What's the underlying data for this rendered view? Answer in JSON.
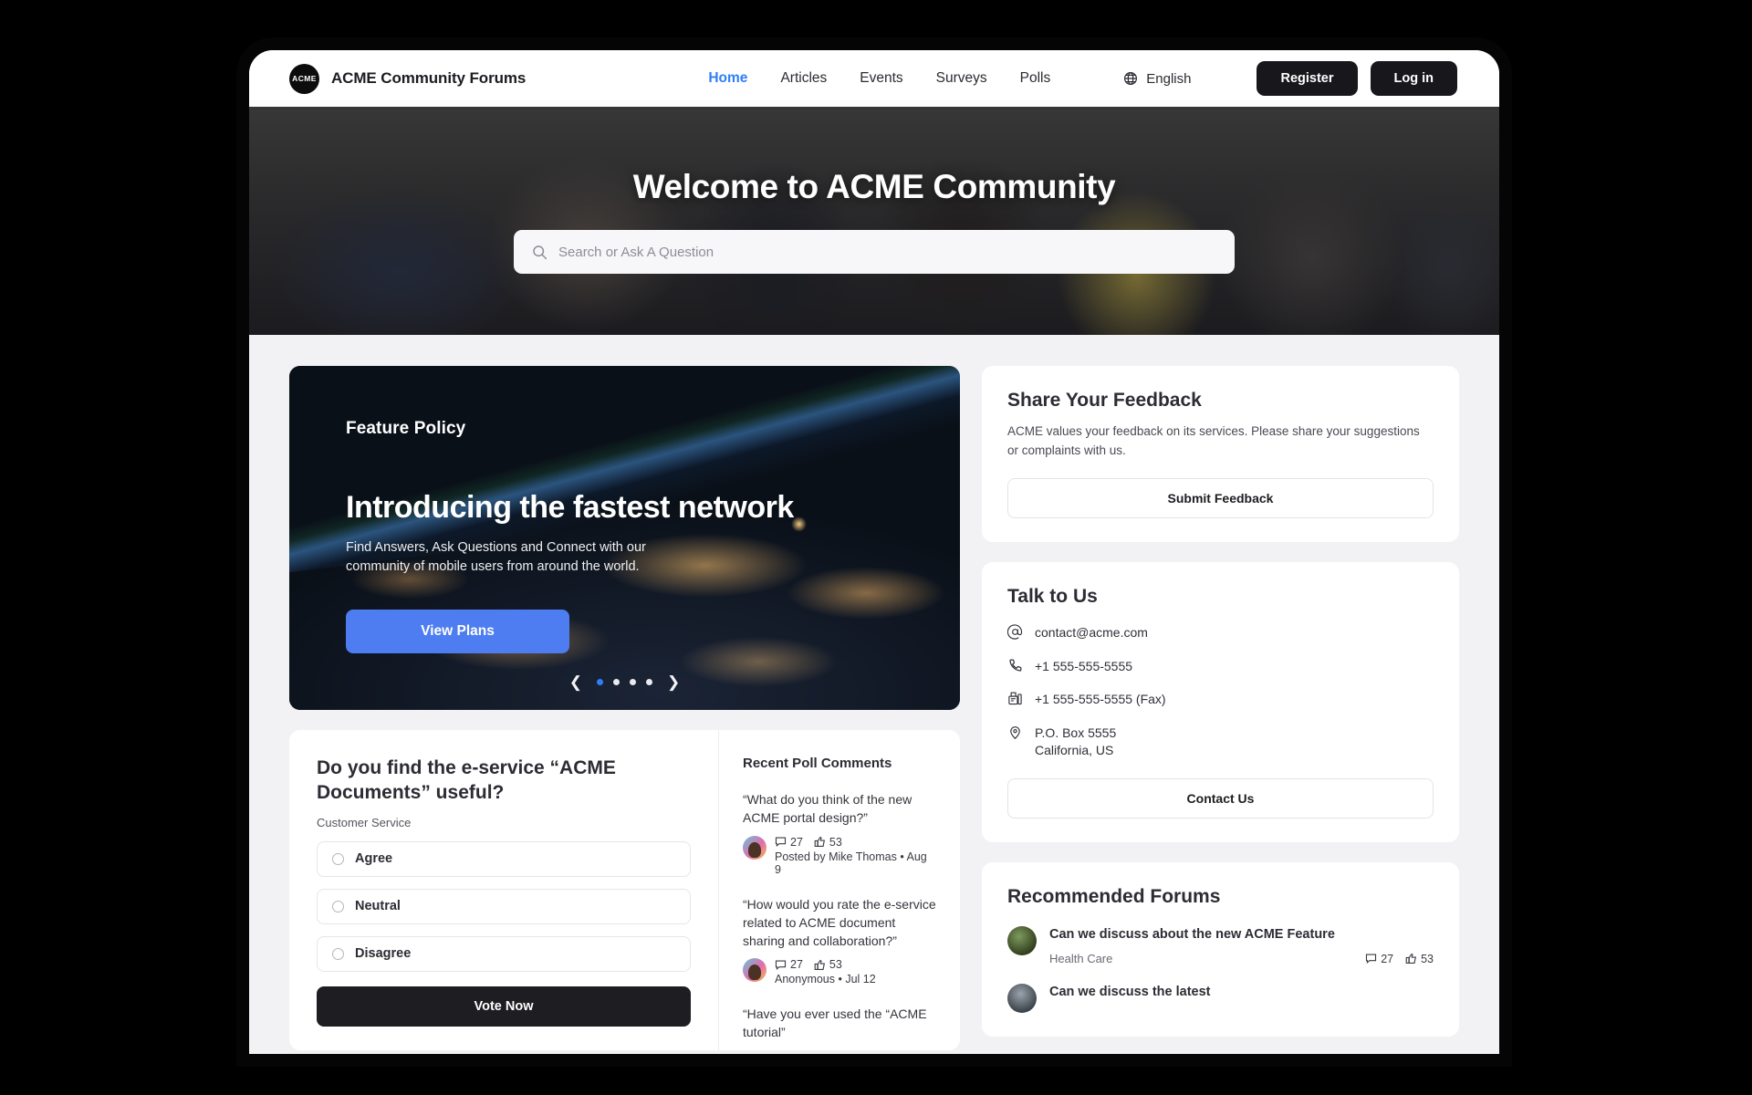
{
  "header": {
    "logo_text": "ACME",
    "brand": "ACME Community Forums",
    "nav": [
      {
        "label": "Home",
        "active": true
      },
      {
        "label": "Articles",
        "active": false
      },
      {
        "label": "Events",
        "active": false
      },
      {
        "label": "Surveys",
        "active": false
      },
      {
        "label": "Polls",
        "active": false
      }
    ],
    "language": "English",
    "register_label": "Register",
    "login_label": "Log in"
  },
  "hero": {
    "title": "Welcome to ACME Community",
    "search_placeholder": "Search or Ask A Question",
    "search_value": ""
  },
  "carousel": {
    "kicker": "Feature Policy",
    "headline": "Introducing the fastest network",
    "subline": "Find Answers, Ask Questions and Connect with our community of mobile users from around the world.",
    "cta_label": "View Plans",
    "slide_count": 4,
    "active_slide": 1,
    "prev_icon": "chevron-left-icon",
    "next_icon": "chevron-right-icon"
  },
  "poll": {
    "question": "Do you find the e-service “ACME Documents” useful?",
    "category": "Customer Service",
    "options": [
      {
        "label": "Agree"
      },
      {
        "label": "Neutral"
      },
      {
        "label": "Disagree"
      }
    ],
    "vote_label": "Vote Now",
    "comments_title": "Recent Poll Comments",
    "comments": [
      {
        "quote": "“What do you think of the new ACME portal design?”",
        "comment_count": "27",
        "like_count": "53",
        "byline": "Posted by Mike Thomas • Aug 9"
      },
      {
        "quote": "“How would you rate the e-service related to ACME document sharing and collaboration?”",
        "comment_count": "27",
        "like_count": "53",
        "byline": "Anonymous • Jul 12"
      },
      {
        "quote": "“Have you ever used the “ACME tutorial”",
        "comment_count": "",
        "like_count": "",
        "byline": ""
      }
    ]
  },
  "feedback": {
    "title": "Share Your Feedback",
    "body": "ACME values your feedback on its services. Please share your suggestions or complaints with us.",
    "button_label": "Submit Feedback"
  },
  "talk_to_us": {
    "title": "Talk to Us",
    "email": "contact@acme.com",
    "phone": "+1 555-555-5555",
    "fax": "+1 555-555-5555 (Fax)",
    "address_line1": "P.O. Box 5555",
    "address_line2": "California, US",
    "button_label": "Contact Us"
  },
  "recommended": {
    "title": "Recommended Forums",
    "items": [
      {
        "title": "Can we discuss about the new ACME Feature",
        "category": "Health Care",
        "comment_count": "27",
        "like_count": "53"
      },
      {
        "title": "Can we discuss the latest",
        "category": "",
        "comment_count": "",
        "like_count": ""
      }
    ]
  },
  "colors": {
    "accent_blue": "#2d7ff9",
    "cta_blue": "#4d7df0",
    "dark": "#17171c",
    "page_bg": "#f2f2f4"
  }
}
